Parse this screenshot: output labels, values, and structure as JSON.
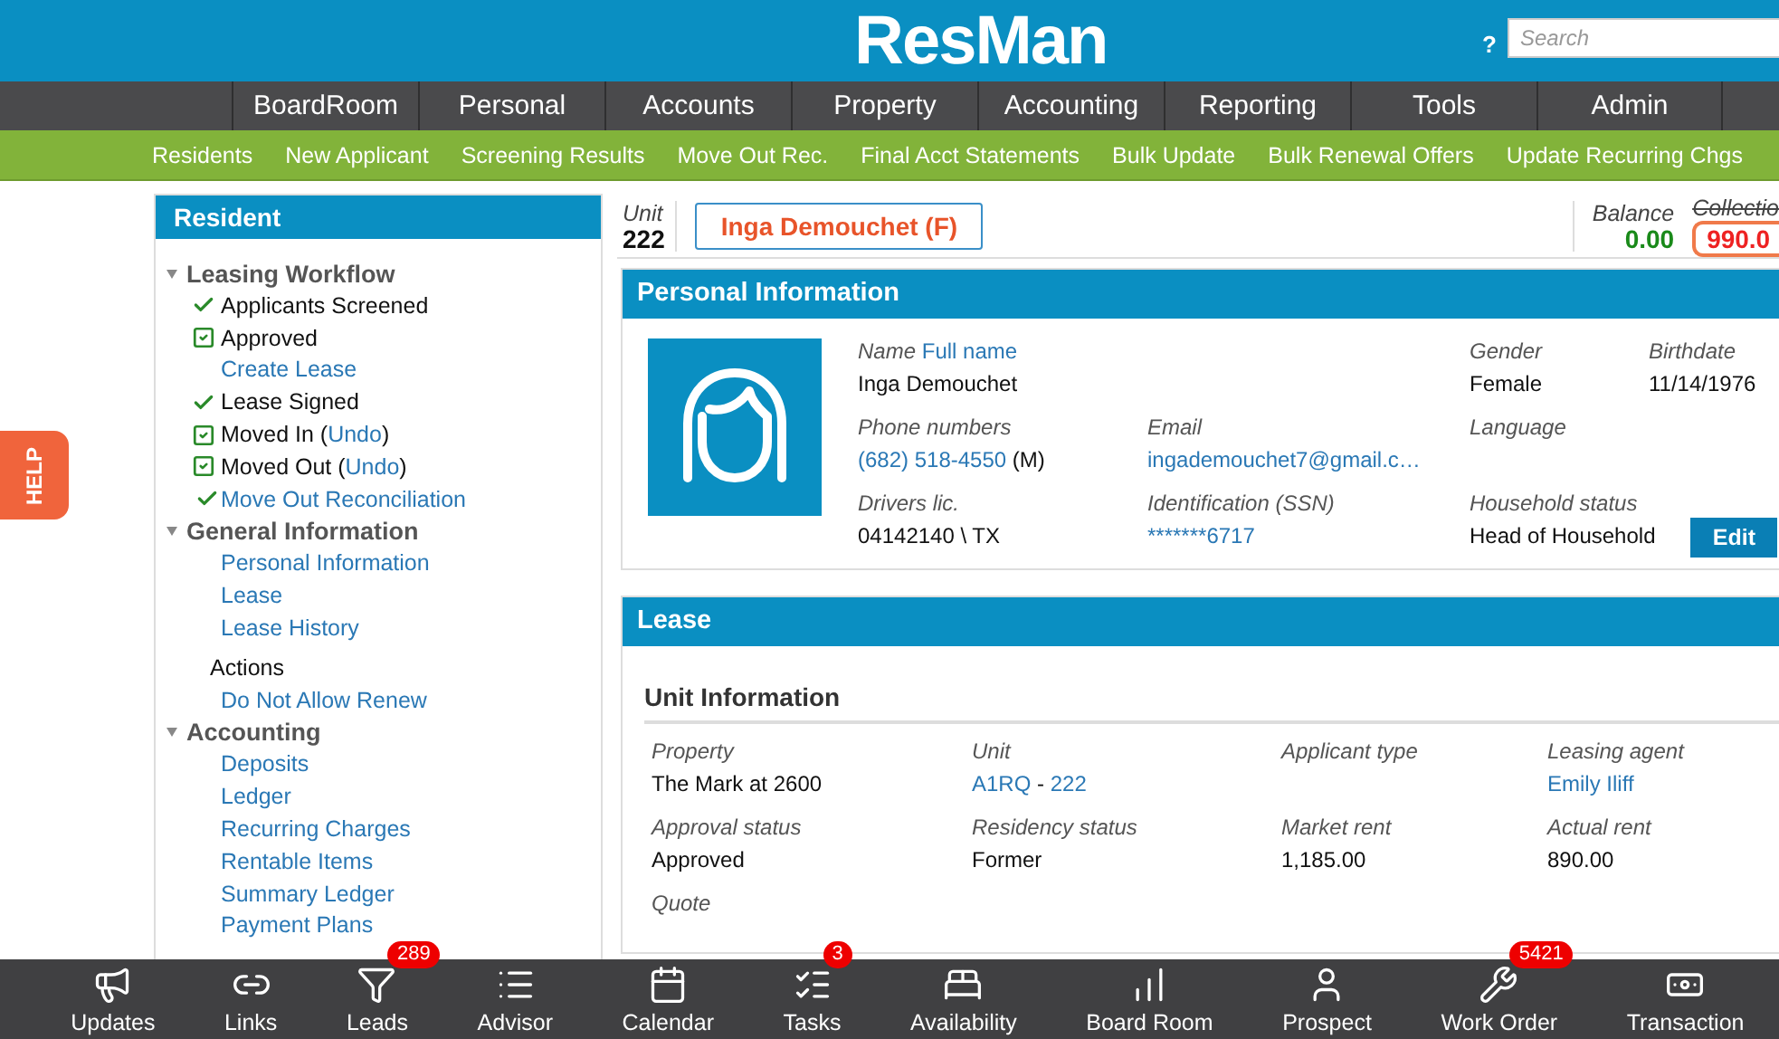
{
  "header": {
    "logo": "ResMan",
    "help": "?",
    "search": {
      "placeholder": "Search"
    }
  },
  "main_nav": [
    {
      "label": "BoardRoom"
    },
    {
      "label": "Personal"
    },
    {
      "label": "Accounts"
    },
    {
      "label": "Property"
    },
    {
      "label": "Accounting"
    },
    {
      "label": "Reporting"
    },
    {
      "label": "Tools"
    },
    {
      "label": "Admin"
    }
  ],
  "sub_nav": [
    {
      "label": "Residents"
    },
    {
      "label": "New Applicant"
    },
    {
      "label": "Screening Results"
    },
    {
      "label": "Move Out Rec."
    },
    {
      "label": "Final Acct Statements"
    },
    {
      "label": "Bulk Update"
    },
    {
      "label": "Bulk Renewal Offers"
    },
    {
      "label": "Update Recurring Chgs"
    }
  ],
  "help_tab": "HELP",
  "sidebar": {
    "title": "Resident",
    "sections": [
      {
        "title": "Leasing Workflow",
        "expanded": true,
        "items": [
          {
            "kind": "done",
            "label": "Applicants Screened"
          },
          {
            "kind": "checked",
            "label": "Approved"
          },
          {
            "kind": "link",
            "label": "Create Lease"
          },
          {
            "kind": "done",
            "label": "Lease Signed"
          },
          {
            "kind": "checked",
            "label": "Moved In (",
            "link": "Undo",
            "tail": ")"
          },
          {
            "kind": "checked",
            "label": "Moved Out (",
            "link": "Undo",
            "tail": ")"
          },
          {
            "kind": "done-link",
            "label": "Move Out Reconciliation"
          }
        ]
      },
      {
        "title": "General Information",
        "expanded": true,
        "items": [
          {
            "kind": "link",
            "label": "Personal Information"
          },
          {
            "kind": "link",
            "label": "Lease"
          },
          {
            "kind": "link",
            "label": "Lease History"
          },
          {
            "kind": "heading",
            "label": "Actions"
          },
          {
            "kind": "link",
            "label": "Do Not Allow Renew"
          }
        ]
      },
      {
        "title": "Accounting",
        "expanded": true,
        "items": [
          {
            "kind": "link",
            "label": "Deposits"
          },
          {
            "kind": "link",
            "label": "Ledger"
          },
          {
            "kind": "link",
            "label": "Recurring Charges"
          },
          {
            "kind": "link",
            "label": "Rentable Items"
          },
          {
            "kind": "link",
            "label": "Summary Ledger"
          },
          {
            "kind": "link",
            "label": "Payment Plans"
          }
        ]
      }
    ]
  },
  "resident_bar": {
    "unit_label": "Unit",
    "unit": "222",
    "name": "Inga Demouchet (F)",
    "balance_label": "Balance",
    "balance": "0.00",
    "collection_label": "Collectio",
    "collection": "990.0"
  },
  "personal_info": {
    "title": "Personal Information",
    "rows": [
      [
        {
          "label": "Name",
          "label_link": "Full name",
          "value": "Inga Demouchet"
        },
        "",
        {
          "label": "Gender",
          "value": "Female"
        },
        {
          "label": "Birthdate",
          "value": "11/14/1976"
        }
      ],
      [
        {
          "label": "Phone numbers",
          "value": "(682) 518-4550",
          "value_link": true,
          "suffix": " (M)"
        },
        {
          "label": "Email",
          "value": "ingademouchet7@gmail.c…",
          "value_link": true
        },
        {
          "label": "Language"
        },
        ""
      ],
      [
        {
          "label": "Drivers lic.",
          "value": "04142140 \\ TX"
        },
        {
          "label": "Identification (SSN)",
          "value": "*******6717",
          "value_link": true
        },
        {
          "label": "Household status",
          "value": "Head of Household"
        },
        ""
      ]
    ],
    "edit_button": "Edit"
  },
  "lease": {
    "title": "Lease",
    "subtitle": "Unit Information",
    "rows": [
      [
        {
          "label": "Property",
          "value": "The Mark at 2600"
        },
        {
          "label": "Unit",
          "value": "A1RQ",
          "value_link": true,
          "sep": " - ",
          "value2": "222"
        },
        {
          "label": "Applicant type"
        },
        {
          "label": "Leasing agent",
          "value": "Emily Iliff",
          "value_link": true
        }
      ],
      [
        {
          "label": "Approval status",
          "value": "Approved"
        },
        {
          "label": "Residency status",
          "value": "Former"
        },
        {
          "label": "Market rent",
          "value": "1,185.00"
        },
        {
          "label": "Actual rent",
          "value": "890.00"
        }
      ],
      [
        {
          "label": "Quote"
        }
      ]
    ]
  },
  "bottom_bar": [
    {
      "label": "Updates"
    },
    {
      "label": "Links"
    },
    {
      "label": "Leads",
      "badge": "289"
    },
    {
      "label": "Advisor"
    },
    {
      "label": "Calendar"
    },
    {
      "label": "Tasks",
      "badge": "3"
    },
    {
      "label": "Availability"
    },
    {
      "label": "Board Room"
    },
    {
      "label": "Prospect"
    },
    {
      "label": "Work Order",
      "badge": "5421"
    },
    {
      "label": "Transaction"
    }
  ]
}
